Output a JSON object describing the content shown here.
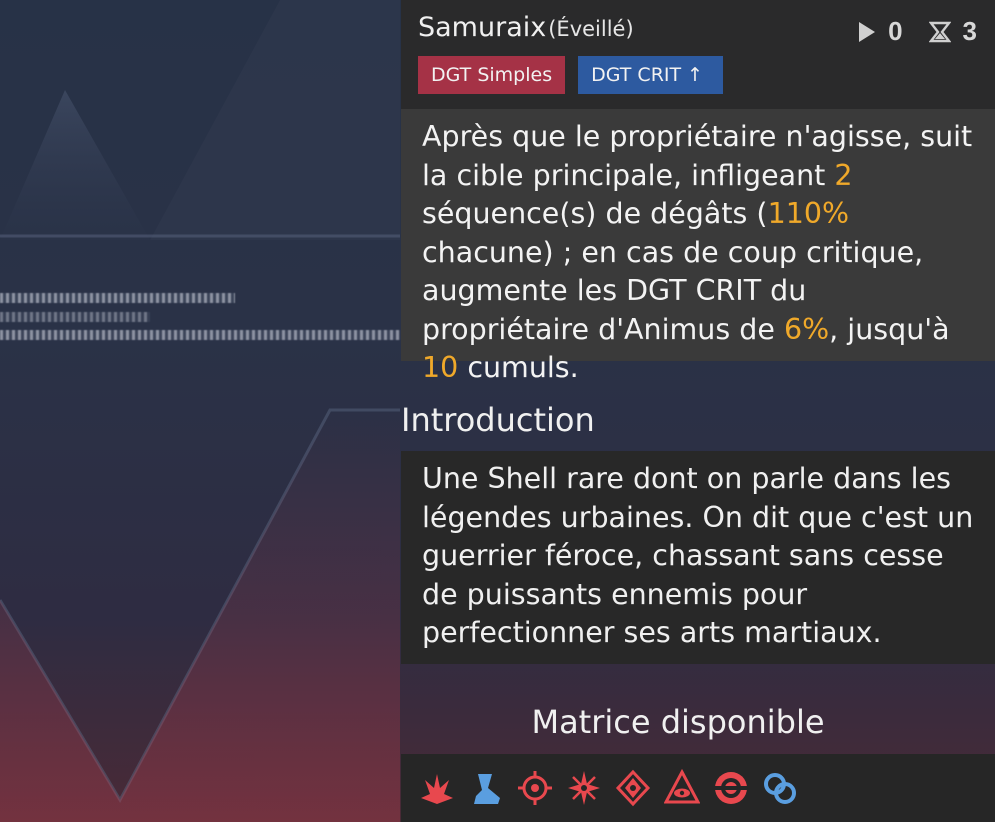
{
  "header": {
    "title": "Samuraix",
    "subtitle": "(Éveillé)",
    "counter_play": "0",
    "counter_hourglass": "3"
  },
  "tags": {
    "damage_type": "DGT Simples",
    "crit": "DGT CRIT ↑"
  },
  "description": {
    "part1": "Après que le propriétaire n'agisse, suit la cible principale, infligeant ",
    "hits": "2",
    "part2": " séquence(s) de dégâts (",
    "percent": "110%",
    "part3": " chacune) ; en cas de coup critique, augmente les DGT CRIT du propriétaire d'Animus de ",
    "crit_bonus": "6%",
    "part4": ", jusqu'à ",
    "max_stacks": "10",
    "part5": " cumuls."
  },
  "introduction": {
    "title": "Introduction",
    "text": "Une Shell rare dont on parle dans les légendes urbaines. On dit que c'est un guerrier féroce, chassant sans cesse de puissants ennemis pour perfectionner ses arts martiaux."
  },
  "matrix": {
    "title": "Matrice disponible",
    "icons": [
      "flame-burst-icon",
      "boot-icon",
      "crosshair-icon",
      "star-burst-icon",
      "diamond-eye-icon",
      "eye-triangle-icon",
      "ring-target-icon",
      "chain-link-icon"
    ]
  },
  "colors": {
    "highlight": "#f0a92a",
    "tag_red": "#a53246",
    "tag_blue": "#2d5aa0",
    "icon_red": "#e8484e",
    "icon_blue": "#5a9ee0"
  }
}
